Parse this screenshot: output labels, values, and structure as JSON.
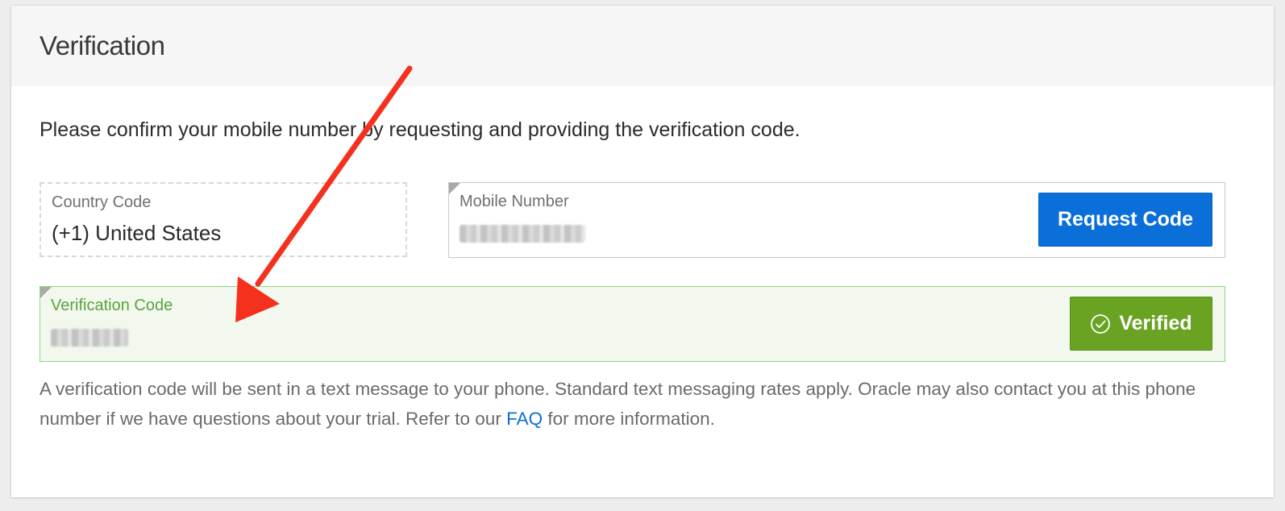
{
  "header": {
    "title": "Verification"
  },
  "instructions": "Please confirm your mobile number by requesting and providing the verification code.",
  "country_field": {
    "label": "Country Code",
    "value": "(+1) United States"
  },
  "mobile_field": {
    "label": "Mobile Number",
    "value_redacted": true,
    "request_button_label": "Request Code"
  },
  "verification_field": {
    "label": "Verification Code",
    "value_redacted": true,
    "verified_button_label": "Verified",
    "verified_icon": "check-circle-icon"
  },
  "note": {
    "text_before_link": "A verification code will be sent in a text message to your phone. Standard text messaging rates apply. Oracle may also contact you at this phone number if we have questions about your trial. Refer to our ",
    "link_text": "FAQ",
    "text_after_link": " for more information."
  },
  "colors": {
    "primary_button": "#0a6fd8",
    "verified_button": "#6aa322",
    "verified_border": "#8fd57e",
    "verified_background": "#f2f8ee",
    "verified_label": "#5aa33b",
    "annotation_arrow": "#f4311e",
    "link": "#0a6fd8"
  }
}
